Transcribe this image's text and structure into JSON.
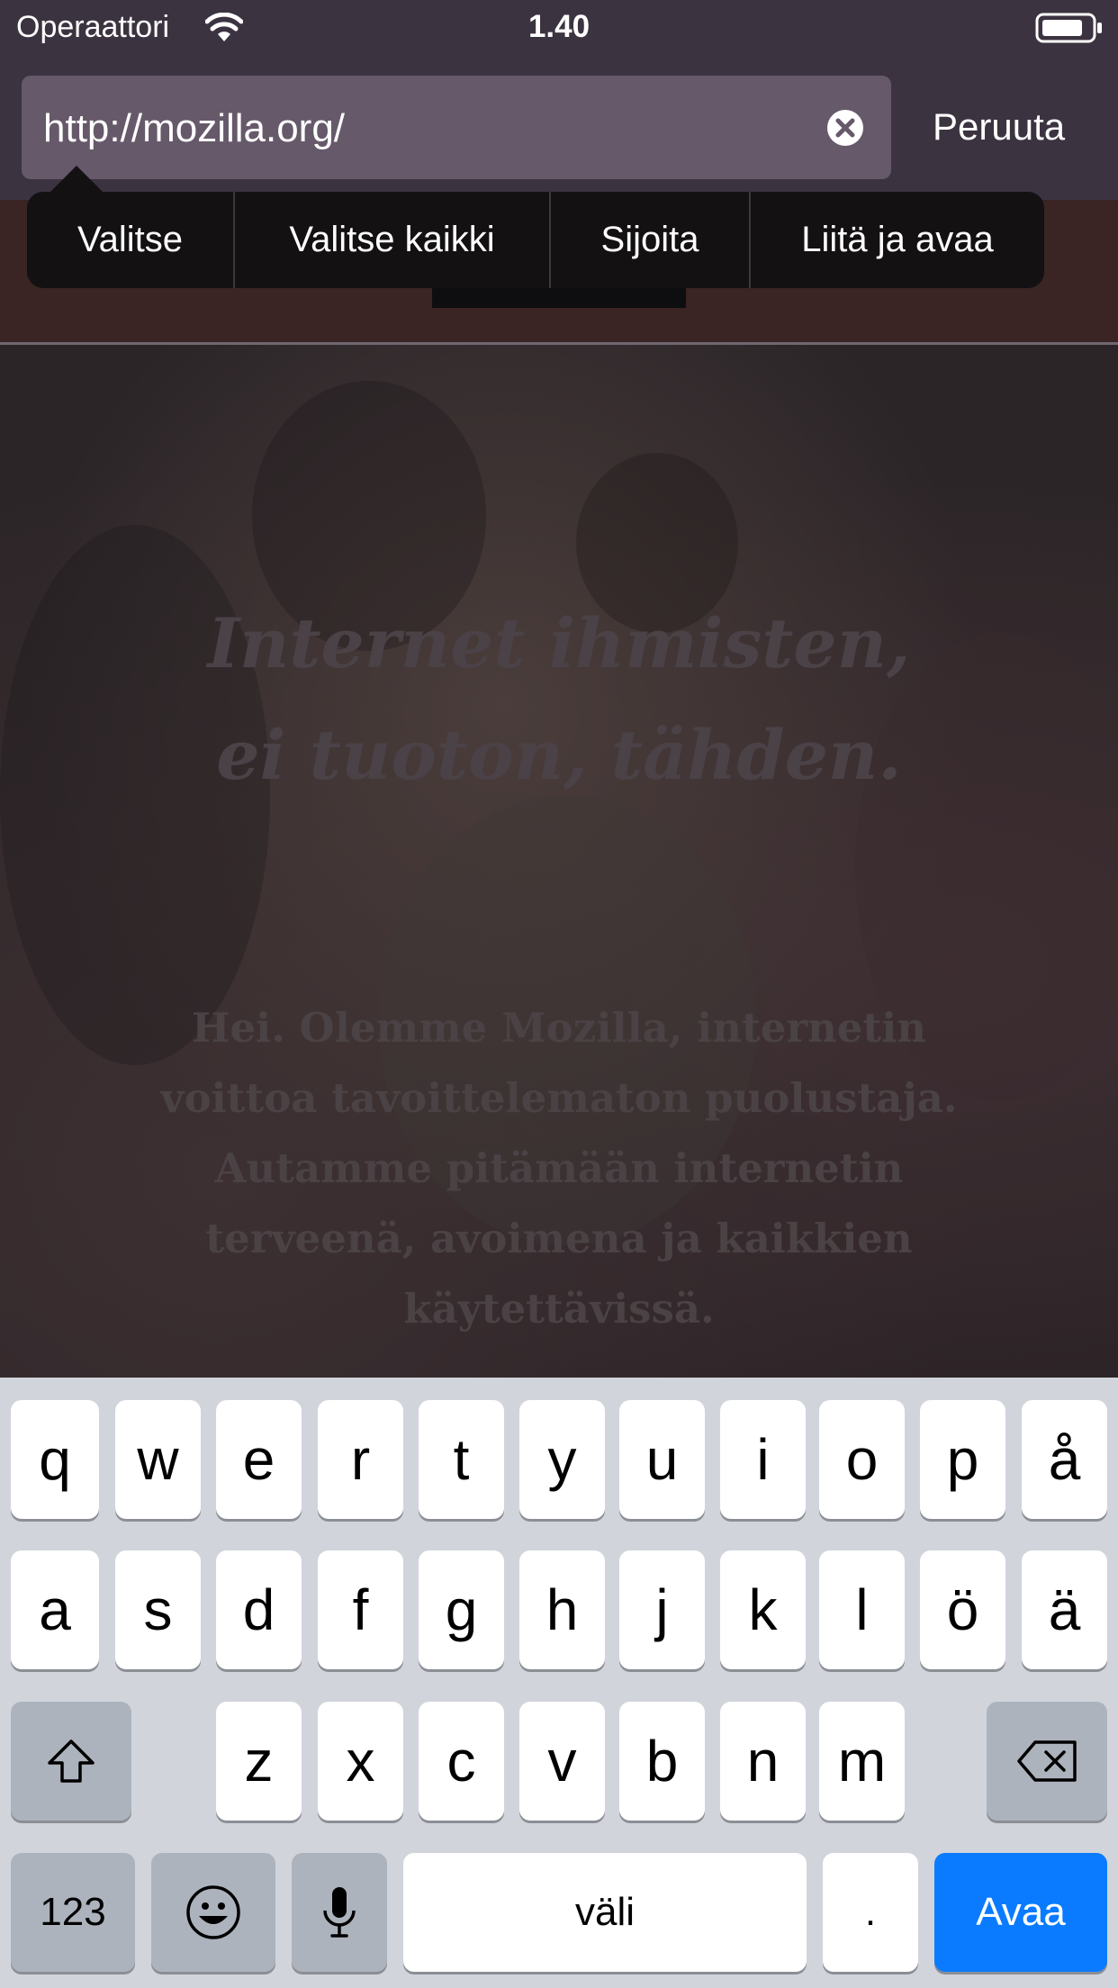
{
  "status_bar": {
    "carrier": "Operaattori",
    "time": "1.40",
    "wifi_icon": "wifi-icon",
    "battery_icon": "battery-icon"
  },
  "url_bar": {
    "url": "http://mozilla.org/",
    "clear_icon": "clear-text-icon",
    "cancel_label": "Peruuta"
  },
  "edit_menu": {
    "items": [
      "Valitse",
      "Valitse kaikki",
      "Sijoita",
      "Liitä ja avaa"
    ]
  },
  "page": {
    "headline": [
      "Internet ihmisten,",
      "ei tuoton, tähden."
    ],
    "intro": "Hei. Olemme Mozilla, internetin voittoa tavoittelematon puolustaja. Autamme pitämään internetin terveenä, avoimena ja kaikkien käytettävissä."
  },
  "keyboard": {
    "row1": [
      "q",
      "w",
      "e",
      "r",
      "t",
      "y",
      "u",
      "i",
      "o",
      "p",
      "å"
    ],
    "row2": [
      "a",
      "s",
      "d",
      "f",
      "g",
      "h",
      "j",
      "k",
      "l",
      "ö",
      "ä"
    ],
    "row3": [
      "z",
      "x",
      "c",
      "v",
      "b",
      "n",
      "m"
    ],
    "numbers_label": "123",
    "space_label": "väli",
    "period_label": ".",
    "go_label": "Avaa",
    "shift_icon": "shift-icon",
    "delete_icon": "backspace-icon",
    "emoji_icon": "emoji-icon",
    "mic_icon": "microphone-icon"
  },
  "colors": {
    "go_key": "#0a7bff",
    "keyboard_bg": "#d1d4db",
    "url_field": "#66596a"
  }
}
